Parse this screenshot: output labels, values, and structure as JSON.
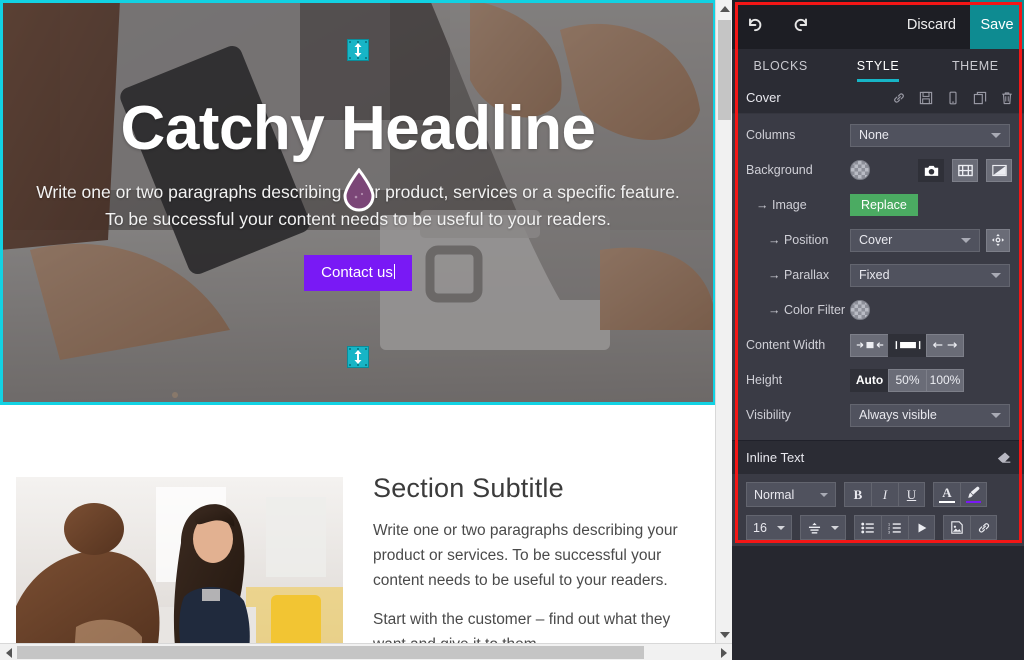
{
  "preview": {
    "hero": {
      "headline": "Catchy Headline",
      "paragraph_line1": "Write one or two paragraphs describing your product, services or a specific feature.",
      "paragraph_line2": "To be successful your content needs to be useful to your readers.",
      "button_label": "Contact us",
      "button_color": "#7919f5",
      "selection_border_color": "#12d2e3",
      "resize_handle_color": "#17b5c6",
      "top_handle_icon": "vertical-resize-icon",
      "bottom_handle_icon": "vertical-resize-icon",
      "cursor_icon": "eyedropper-droplet-icon",
      "cursor_color": "#7b4677"
    },
    "section2": {
      "subtitle": "Section Subtitle",
      "paragraph1": "Write one or two paragraphs describing your product or services. To be successful your content needs to be useful to your readers.",
      "paragraph2": "Start with the customer – find out what they want and give it to them."
    },
    "scrollbars": {
      "vertical_up_icon": "scroll-up-arrow-icon",
      "vertical_down_icon": "scroll-down-arrow-icon",
      "horizontal_left_icon": "scroll-left-arrow-icon",
      "horizontal_right_icon": "scroll-right-arrow-icon"
    }
  },
  "panel": {
    "topbar": {
      "undo_icon": "undo-icon",
      "redo_icon": "redo-icon",
      "discard_label": "Discard",
      "save_label": "Save",
      "save_color": "#0e8b91"
    },
    "tabs": [
      {
        "label": "BLOCKS",
        "active": false
      },
      {
        "label": "STYLE",
        "active": true
      },
      {
        "label": "THEME",
        "active": false
      }
    ],
    "tab_accent": "#17b5c6",
    "block": {
      "title": "Cover",
      "icons": [
        "link-icon",
        "save-floppy-icon",
        "mobile-device-icon",
        "duplicate-icon",
        "trash-icon"
      ]
    },
    "options": {
      "columns": {
        "label": "Columns",
        "value": "None"
      },
      "background": {
        "label": "Background",
        "swatch_icon": "transparent-color-swatch",
        "buttons": [
          {
            "icon": "camera-icon",
            "selected": true
          },
          {
            "icon": "video-film-icon",
            "selected": false
          },
          {
            "icon": "gradient-icon",
            "selected": false
          }
        ]
      },
      "image": {
        "label": "→ Image",
        "button_label": "Replace",
        "button_color": "#4bab62"
      },
      "position": {
        "label": "→ Position",
        "value": "Cover",
        "extra_icon": "reposition-move-icon"
      },
      "parallax": {
        "label": "→ Parallax",
        "value": "Fixed"
      },
      "color_filter": {
        "label": "→ Color Filter",
        "swatch_icon": "transparent-color-swatch"
      },
      "content_width": {
        "label": "Content Width",
        "options": [
          {
            "icon": "width-narrow-icon",
            "selected": false
          },
          {
            "icon": "width-normal-icon",
            "selected": true
          },
          {
            "icon": "width-wide-icon",
            "selected": false
          }
        ]
      },
      "height": {
        "label": "Height",
        "options": [
          {
            "label": "Auto",
            "selected": true
          },
          {
            "label": "50%",
            "selected": false
          },
          {
            "label": "100%",
            "selected": false
          }
        ]
      },
      "visibility": {
        "label": "Visibility",
        "value": "Always visible"
      }
    },
    "inline_text": {
      "title": "Inline Text",
      "header_icon": "eraser-icon",
      "row1": {
        "style_value": "Normal",
        "bold_label": "B",
        "italic_label": "I",
        "underline_label": "U",
        "font_color_label": "A",
        "font_color_underline": "#ffffff",
        "highlight_icon": "paint-brush-icon",
        "highlight_underline": "#7919f5"
      },
      "row2": {
        "font_size": "16",
        "align_icon": "align-icon",
        "bullet_list_icon": "bullet-list-icon",
        "numbered_list_icon": "numbered-list-icon",
        "indent_icon": "indent-arrow-icon",
        "image_icon": "insert-image-icon",
        "link_icon": "insert-link-icon"
      }
    }
  },
  "annotation": {
    "highlight_color": "#f41616"
  }
}
